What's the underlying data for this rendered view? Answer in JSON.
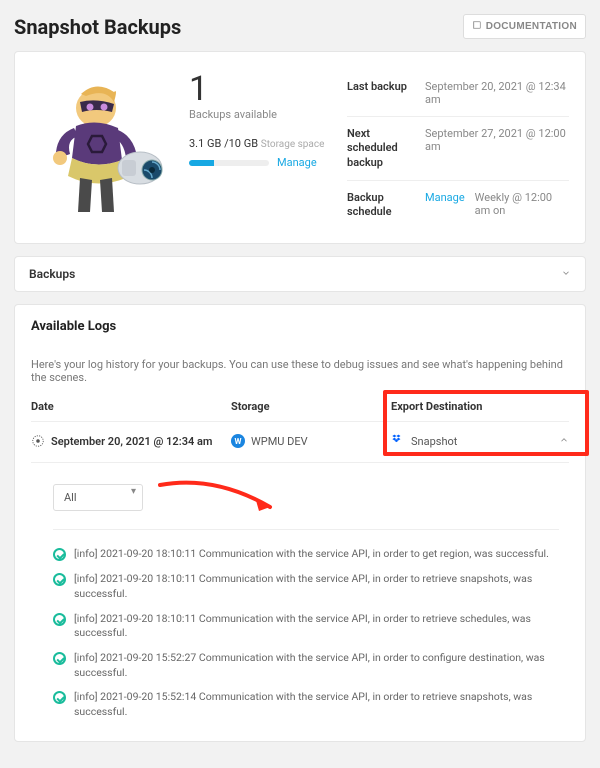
{
  "header": {
    "title": "Snapshot Backups",
    "doc_button": "DOCUMENTATION"
  },
  "summary": {
    "count": "1",
    "count_label": "Backups available",
    "storage_used": "3.1 GB",
    "storage_total": "/10 GB",
    "storage_label": "Storage space",
    "manage": "Manage",
    "meta": [
      {
        "label": "Last backup",
        "value": "September 20, 2021 @ 12:34 am"
      },
      {
        "label": "Next scheduled backup",
        "value": "September 27, 2021 @ 12:00 am"
      },
      {
        "label": "Backup schedule",
        "link": "Manage",
        "value": "Weekly @ 12:00 am on"
      }
    ]
  },
  "backups_section": {
    "title": "Backups"
  },
  "logs": {
    "title": "Available Logs",
    "desc": "Here's your log history for your backups. You can use these to debug issues and see what's happening behind the scenes.",
    "columns": {
      "date": "Date",
      "storage": "Storage",
      "export": "Export Destination"
    },
    "row": {
      "date": "September 20, 2021 @ 12:34 am",
      "storage": "WPMU DEV",
      "export": "Snapshot"
    },
    "filter": {
      "value": "All"
    },
    "lines": [
      "[info] 2021-09-20 18:10:11 Communication with the service API, in order to get region, was successful.",
      "[info] 2021-09-20 18:10:11 Communication with the service API, in order to retrieve snapshots, was successful.",
      "[info] 2021-09-20 18:10:11 Communication with the service API, in order to retrieve schedules, was successful.",
      "[info] 2021-09-20 15:52:27 Communication with the service API, in order to configure destination, was successful.",
      "[info] 2021-09-20 15:52:14 Communication with the service API, in order to retrieve snapshots, was successful."
    ]
  }
}
